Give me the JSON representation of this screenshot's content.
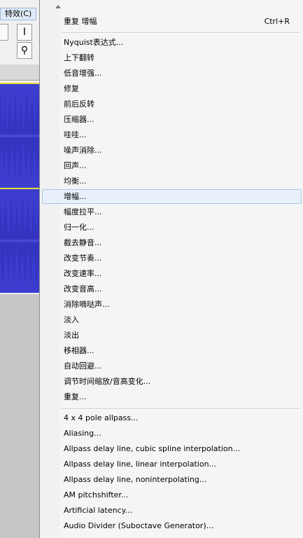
{
  "app": {
    "menubar_label": "特效(C)"
  },
  "menu": {
    "top_items": [
      {
        "label": "重复 增幅",
        "shortcut": "Ctrl+R"
      }
    ],
    "builtin_items": [
      "Nyquist表达式...",
      "上下翻转",
      "低音增强...",
      "修复",
      "前后反转",
      "压缩器...",
      "哇哇...",
      "噪声消除...",
      "回声...",
      "均衡...",
      "增幅...",
      "幅度拉平...",
      "归一化...",
      "截去静音...",
      "改变节奏...",
      "改变速率...",
      "改变音高...",
      "消除嘀哒声...",
      "淡入",
      "淡出",
      "移相器...",
      "自动回避...",
      "调节时间缩放/音高变化...",
      "重复..."
    ],
    "plugin_items": [
      "4 x 4 pole allpass...",
      "Aliasing...",
      "Allpass delay line, cubic spline interpolation...",
      "Allpass delay line, linear interpolation...",
      "Allpass delay line, noninterpolating...",
      "AM pitchshifter...",
      "Artificial latency...",
      "Audio Divider (Suboctave Generator)..."
    ],
    "hovered_item": "增幅..."
  },
  "colors": {
    "waveform": "#3c3dcf",
    "hover_bg": "#e8f1fb",
    "hover_border": "#a8c8ea"
  }
}
